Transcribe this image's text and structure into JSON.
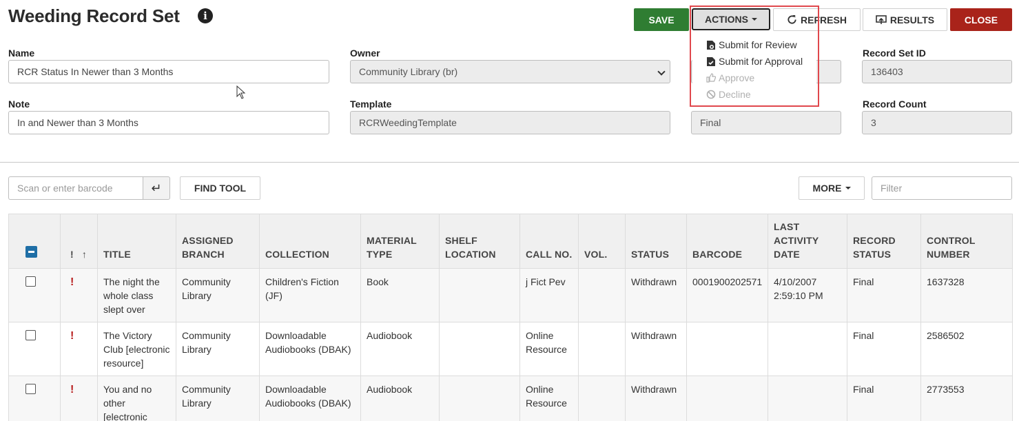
{
  "page": {
    "title": "Weeding Record Set"
  },
  "toolbar": {
    "save": "SAVE",
    "actions": "ACTIONS",
    "refresh": "REFRESH",
    "results": "RESULTS",
    "close": "CLOSE"
  },
  "actions_menu": {
    "items": [
      {
        "label": "Submit for Review",
        "icon": "eye-doc-icon",
        "enabled": true
      },
      {
        "label": "Submit for Approval",
        "icon": "check-doc-icon",
        "enabled": true
      },
      {
        "label": "Approve",
        "icon": "thumbs-up-icon",
        "enabled": false
      },
      {
        "label": "Decline",
        "icon": "ban-icon",
        "enabled": false
      }
    ]
  },
  "form": {
    "name_label": "Name",
    "name_value": "RCR Status In Newer than 3 Months",
    "owner_label": "Owner",
    "owner_value": "Community Library (br)",
    "record_set_id_label": "Record Set ID",
    "record_set_id_value": "136403",
    "note_label": "Note",
    "note_value": "In and Newer than 3 Months",
    "template_label": "Template",
    "template_value": "RCRWeedingTemplate",
    "status_value": "Final",
    "record_count_label": "Record Count",
    "record_count_value": "3"
  },
  "toolbar2": {
    "barcode_placeholder": "Scan or enter barcode",
    "find_tool": "FIND TOOL",
    "more": "MORE",
    "filter_placeholder": "Filter"
  },
  "table": {
    "headers": {
      "excl": "!",
      "title": "TITLE",
      "assigned_branch": "ASSIGNED BRANCH",
      "collection": "COLLECTION",
      "material_type": "MATERIAL TYPE",
      "shelf_location": "SHELF LOCATION",
      "call_no": "CALL NO.",
      "vol": "VOL.",
      "status": "STATUS",
      "barcode": "BARCODE",
      "last_activity_date": "LAST ACTIVITY DATE",
      "record_status": "RECORD STATUS",
      "control_number": "CONTROL NUMBER"
    },
    "rows": [
      {
        "excl": "!",
        "title": "The night the whole class slept over",
        "branch": "Community Library",
        "collection": "Children's Fiction (JF)",
        "material": "Book",
        "shelf": "",
        "call": "j Fict Pev",
        "vol": "",
        "status": "Withdrawn",
        "barcode": "0001900202571",
        "last_activity": "4/10/2007 2:59:10 PM",
        "record_status": "Final",
        "control": "1637328"
      },
      {
        "excl": "!",
        "title": "The Victory Club [electronic resource]",
        "branch": "Community Library",
        "collection": "Downloadable Audiobooks (DBAK)",
        "material": "Audiobook",
        "shelf": "",
        "call": "Online Resource",
        "vol": "",
        "status": "Withdrawn",
        "barcode": "",
        "last_activity": "",
        "record_status": "Final",
        "control": "2586502"
      },
      {
        "excl": "!",
        "title": "You and no other [electronic",
        "branch": "Community Library",
        "collection": "Downloadable Audiobooks (DBAK)",
        "material": "Audiobook",
        "shelf": "",
        "call": "Online Resource",
        "vol": "",
        "status": "Withdrawn",
        "barcode": "",
        "last_activity": "",
        "record_status": "Final",
        "control": "2773553"
      }
    ]
  },
  "colors": {
    "save": "#2f7d32",
    "close": "#a9231a",
    "highlight": "#e0474c",
    "checkbox_header": "#1f6fa6",
    "alert": "#b71c1c"
  }
}
